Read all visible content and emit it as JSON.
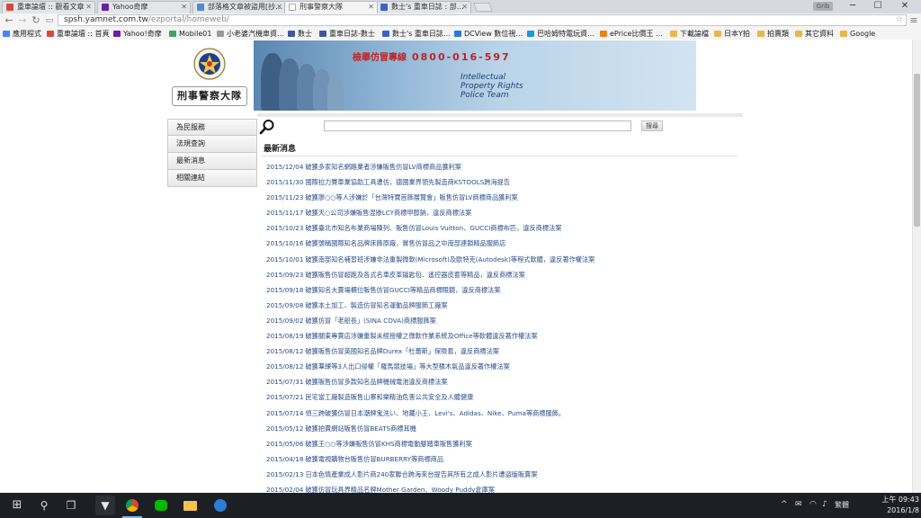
{
  "browser": {
    "tabs": [
      {
        "label": "重車論壇 :: 觀看文章",
        "icon_color": "#d44a3a",
        "active": false
      },
      {
        "label": "Yahoo奇摩",
        "icon_color": "#6b1fa5",
        "active": false
      },
      {
        "label": "部落格文章被盜用[抄…",
        "icon_color": "#4c8bd5",
        "active": false
      },
      {
        "label": "刑事警察大隊",
        "icon_color": "#888888",
        "active": true
      },
      {
        "label": "數士's 重車日誌 : 部…",
        "icon_color": "#3b63c4",
        "active": false
      }
    ],
    "user_badge": "Grib",
    "url_host": "spsh.yamnet.com.tw",
    "url_path": "/ezportal/homeweb/",
    "bookmarks": [
      {
        "label": "應用程式",
        "icon": "apps-icon",
        "color": "#4285f4"
      },
      {
        "label": "重車論壇 :: 首頁",
        "icon": "bookmark-icon",
        "color": "#d44a3a"
      },
      {
        "label": "Yahoo!奇摩",
        "icon": "yahoo-icon",
        "color": "#6b1fa5"
      },
      {
        "label": "Mobile01",
        "icon": "mobile01-icon",
        "color": "#3aa757"
      },
      {
        "label": "小老婆汽機車資…",
        "icon": "page-icon",
        "color": "#999999"
      },
      {
        "label": "數士",
        "icon": "facebook-icon",
        "color": "#3b5998"
      },
      {
        "label": "重車日誌-數士",
        "icon": "facebook-icon",
        "color": "#3b5998"
      },
      {
        "label": "數士's 重車日誌…",
        "icon": "blog-icon",
        "color": "#3b63c4"
      },
      {
        "label": "DCView 數位視…",
        "icon": "dcview-icon",
        "color": "#2b7bd4"
      },
      {
        "label": "巴哈姆特電玩資…",
        "icon": "bahamut-icon",
        "color": "#1a9ad6"
      },
      {
        "label": "ePrice比價王 …",
        "icon": "eprice-icon",
        "color": "#e8831a"
      },
      {
        "label": "下載論檔",
        "icon": "folder-icon",
        "color": "#e6b84a"
      },
      {
        "label": "日本Y拍",
        "icon": "folder-icon",
        "color": "#e6b84a"
      },
      {
        "label": "拍賣類",
        "icon": "folder-icon",
        "color": "#e6b84a"
      },
      {
        "label": "其它資料",
        "icon": "folder-icon",
        "color": "#e6b84a"
      },
      {
        "label": "Google",
        "icon": "folder-icon",
        "color": "#e6b84a"
      }
    ]
  },
  "site": {
    "logo_title": "刑事警察大隊",
    "banner": {
      "hotline_label": "檢舉仿冒專線",
      "hotline_number": "0800-016-597",
      "english_lines": [
        "Intellectual",
        "Property Rights",
        "Police Team"
      ]
    },
    "sidebar": [
      "為民服務",
      "法規查詢",
      "最新消息",
      "相關連結"
    ],
    "search": {
      "placeholder": "",
      "button_label": "搜尋"
    },
    "news_heading": "最新消息",
    "news": [
      {
        "date": "2015/12/04",
        "title": "破獲多家知名網路業者涉嫌販售仿冒LV商標商品獲利案"
      },
      {
        "date": "2015/11/30",
        "title": "國際拉力賽車業協助工具遭仿，德國業界領先製造商KSTOOLS跨海提告"
      },
      {
        "date": "2015/11/23",
        "title": "破獲廖○○等人涉嫌於「台灣特寶首飾展覽會」販售仿冒LV商標商品獲利案"
      },
      {
        "date": "2015/11/17",
        "title": "破獲天○公司涉嫌販售混掺LCY商標甲醇鈉，違反商標法案"
      },
      {
        "date": "2015/10/23",
        "title": "破獲臺北市知名布業商場陳列、販售仿冒Louis Vuitton、GUCCI商標布匹，違反商標法案"
      },
      {
        "date": "2015/10/16",
        "title": "破獲號稱國際知名品牌床飾原廠，實售仿冒品之中南部連鎖精品服飾店"
      },
      {
        "date": "2015/10/01",
        "title": "破獲南部知名補習班涉嫌非法重製微軟(Microsoft)及歐特克(Autodesk)等程式軟體，違反著作權法案"
      },
      {
        "date": "2015/09/23",
        "title": "破獲販售仿冒超跑及各式名車皮革鑰匙包、遙控器皮套等精品，違反商標法案"
      },
      {
        "date": "2015/09/18",
        "title": "破獲知名大賣場櫃位販售仿冒GUCCI等精品商標眼鏡，違反商標法案"
      },
      {
        "date": "2015/09/08",
        "title": "破獲本土加工、製造仿冒知名運動品牌服飾工廠案"
      },
      {
        "date": "2015/09/02",
        "title": "破獲仿冒「老船長」(SINA COVA)商標服飾案"
      },
      {
        "date": "2015/08/19",
        "title": "破獲關東專賣店涉嫌重製未經授權之微軟作業系統及Office等軟體違反著作權法案"
      },
      {
        "date": "2015/08/12",
        "title": "破獲販售仿冒英國知名品牌Durex「杜蕾斯」保險套，違反商標法案"
      },
      {
        "date": "2015/08/12",
        "title": "破獲羣練等3人出口侵權「羅馬競技場」等大型積木氣品違反著作權法案"
      },
      {
        "date": "2015/07/31",
        "title": "破獲販售仿冒多款知名品牌機械電池違反商標法案"
      },
      {
        "date": "2015/07/21",
        "title": "民宅當工廠製造販售山寨和樂精油危害公共安全及人體健康"
      },
      {
        "date": "2015/07/14",
        "title": "偵三跨破獲仿冒日本潮牌鬼洗い、地藏小王、Levi's、Adidas、Nike、Puma等商標服飾。"
      },
      {
        "date": "2015/05/12",
        "title": "破獲拍賣網站販售仿冒BEATS商標耳機"
      },
      {
        "date": "2015/05/06",
        "title": "破獲王○○等涉嫌販售仿冒KHS商標電動腳踏車販售獲利案"
      },
      {
        "date": "2015/04/18",
        "title": "破獲電視購物台販售仿冒BURBERRY等商標商品"
      },
      {
        "date": "2015/02/13",
        "title": "日本色情產業成人影片商240家聯合跨海來台提告其所有之成人影片遭盜版販賣案"
      },
      {
        "date": "2015/02/04",
        "title": "破獲仿冒玩具界精品名牌Mother Garden、Woody Puddy倉庫案"
      }
    ]
  },
  "taskbar": {
    "ime": "繁體",
    "time": "上午 09:43",
    "date": "2016/1/8"
  },
  "colors": {
    "link": "#2a4d86",
    "hotline": "#c02424",
    "banner_blue": "#8fb5d6"
  }
}
